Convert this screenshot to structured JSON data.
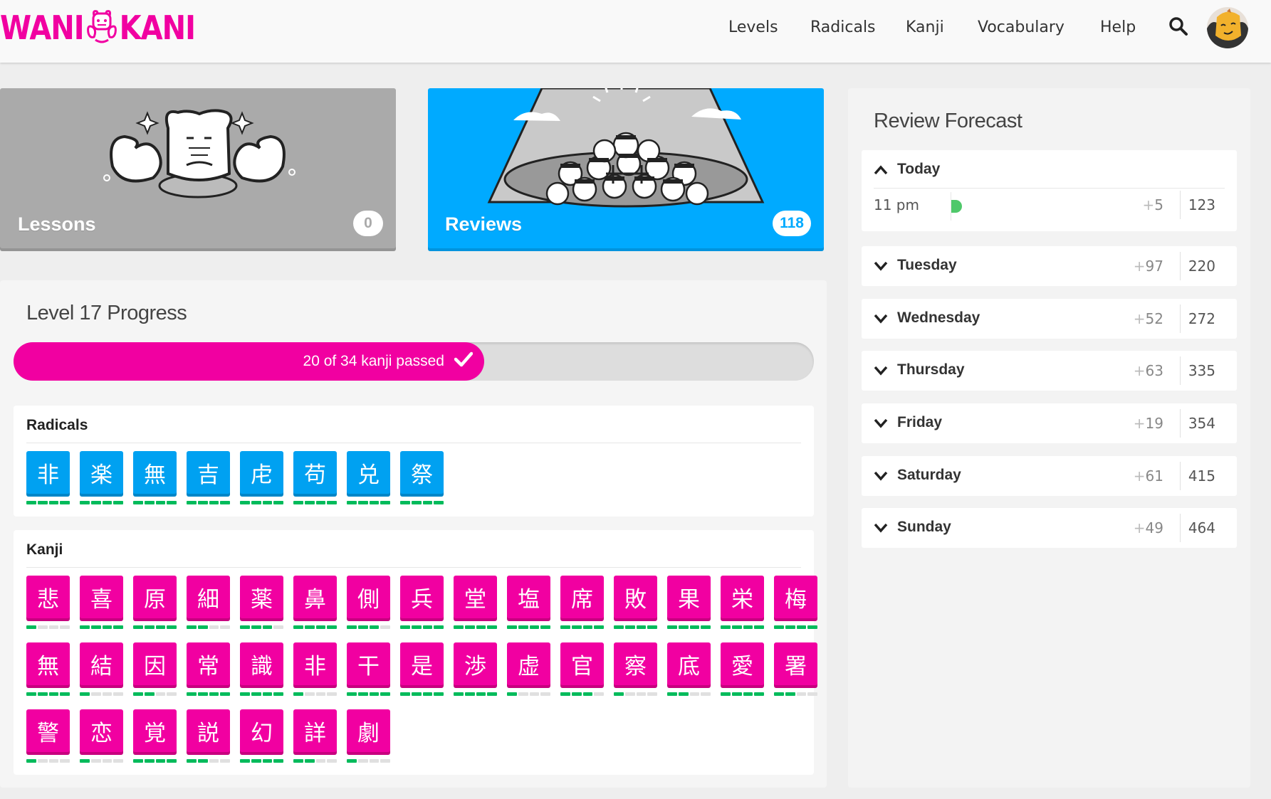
{
  "brand": {
    "left": "WANI",
    "right": "KANI",
    "color": "#f100a1"
  },
  "nav": {
    "items": [
      "Levels",
      "Radicals",
      "Kanji",
      "Vocabulary",
      "Help"
    ]
  },
  "cards": {
    "lessons": {
      "label": "Lessons",
      "count": "0",
      "color": "#aaaaaa"
    },
    "reviews": {
      "label": "Reviews",
      "count": "118",
      "color": "#00aaff"
    }
  },
  "progress": {
    "title": "Level 17 Progress",
    "bar_text": "20 of 34 kanji passed",
    "passed": 20,
    "total": 34
  },
  "radicals": {
    "title": "Radicals",
    "items": [
      "非",
      "楽",
      "無",
      "吉",
      "虍",
      "苟",
      "兑",
      "祭"
    ]
  },
  "kanji": {
    "title": "Kanji",
    "items": [
      {
        "char": "悲",
        "srs": 1
      },
      {
        "char": "喜",
        "srs": 4
      },
      {
        "char": "原",
        "srs": 4
      },
      {
        "char": "細",
        "srs": 2
      },
      {
        "char": "薬",
        "srs": 3
      },
      {
        "char": "鼻",
        "srs": 4
      },
      {
        "char": "側",
        "srs": 3
      },
      {
        "char": "兵",
        "srs": 4
      },
      {
        "char": "堂",
        "srs": 4
      },
      {
        "char": "塩",
        "srs": 4
      },
      {
        "char": "席",
        "srs": 4
      },
      {
        "char": "敗",
        "srs": 4
      },
      {
        "char": "果",
        "srs": 4
      },
      {
        "char": "栄",
        "srs": 4
      },
      {
        "char": "梅",
        "srs": 4
      },
      {
        "char": "無",
        "srs": 4
      },
      {
        "char": "結",
        "srs": 1
      },
      {
        "char": "因",
        "srs": 2
      },
      {
        "char": "常",
        "srs": 4
      },
      {
        "char": "識",
        "srs": 4
      },
      {
        "char": "非",
        "srs": 1
      },
      {
        "char": "干",
        "srs": 4
      },
      {
        "char": "是",
        "srs": 4
      },
      {
        "char": "渉",
        "srs": 4
      },
      {
        "char": "虚",
        "srs": 1
      },
      {
        "char": "官",
        "srs": 3
      },
      {
        "char": "察",
        "srs": 1
      },
      {
        "char": "底",
        "srs": 2
      },
      {
        "char": "愛",
        "srs": 4
      },
      {
        "char": "署",
        "srs": 2
      },
      {
        "char": "警",
        "srs": 1
      },
      {
        "char": "恋",
        "srs": 1
      },
      {
        "char": "覚",
        "srs": 4
      },
      {
        "char": "説",
        "srs": 2
      },
      {
        "char": "幻",
        "srs": 4
      },
      {
        "char": "詳",
        "srs": 2
      },
      {
        "char": "劇",
        "srs": 1
      }
    ]
  },
  "forecast": {
    "title": "Review Forecast",
    "today": {
      "label": "Today",
      "hour": "11 pm",
      "plus": "5",
      "total": "123"
    },
    "days": [
      {
        "label": "Tuesday",
        "plus": "97",
        "total": "220"
      },
      {
        "label": "Wednesday",
        "plus": "52",
        "total": "272"
      },
      {
        "label": "Thursday",
        "plus": "63",
        "total": "335"
      },
      {
        "label": "Friday",
        "plus": "19",
        "total": "354"
      },
      {
        "label": "Saturday",
        "plus": "61",
        "total": "415"
      },
      {
        "label": "Sunday",
        "plus": "49",
        "total": "464"
      }
    ]
  }
}
